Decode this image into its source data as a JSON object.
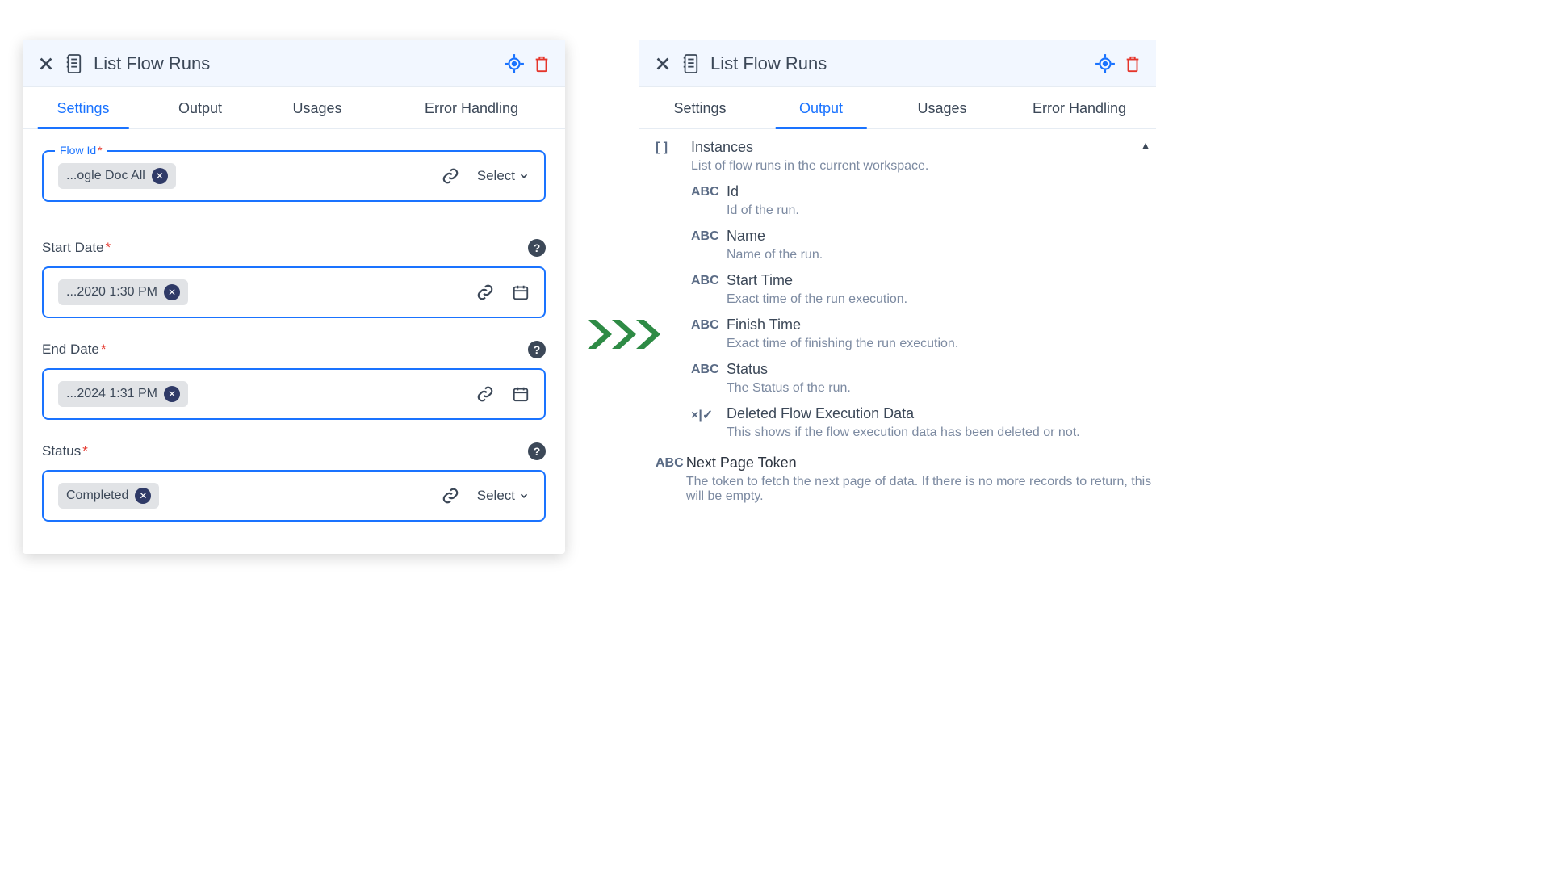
{
  "left": {
    "title": "List Flow Runs",
    "tabs": {
      "settings": "Settings",
      "output": "Output",
      "usages": "Usages",
      "error": "Error Handling",
      "active": "settings"
    },
    "flowId": {
      "label": "Flow Id",
      "chip": "...ogle Doc All",
      "select": "Select"
    },
    "start": {
      "label": "Start Date",
      "chip": "...2020 1:30 PM"
    },
    "end": {
      "label": "End Date",
      "chip": "...2024 1:31 PM"
    },
    "status": {
      "label": "Status",
      "chip": "Completed",
      "select": "Select"
    }
  },
  "right": {
    "title": "List Flow Runs",
    "tabs": {
      "settings": "Settings",
      "output": "Output",
      "usages": "Usages",
      "error": "Error Handling",
      "active": "output"
    },
    "root": {
      "icon": "[ ]",
      "name": "Instances",
      "desc": "List of flow runs in the current workspace."
    },
    "props": [
      {
        "icon": "ABC",
        "name": "Id",
        "desc": "Id of the run."
      },
      {
        "icon": "ABC",
        "name": "Name",
        "desc": "Name of the run."
      },
      {
        "icon": "ABC",
        "name": "Start Time",
        "desc": "Exact time of the run execution."
      },
      {
        "icon": "ABC",
        "name": "Finish Time",
        "desc": "Exact time of finishing the run execution."
      },
      {
        "icon": "ABC",
        "name": "Status",
        "desc": "The Status of the run."
      },
      {
        "icon": "×|✓",
        "name": "Deleted Flow Execution Data",
        "desc": "This shows if the flow execution data has been deleted or not."
      }
    ],
    "next": {
      "icon": "ABC",
      "name": "Next Page Token",
      "desc": "The token to fetch the next page of data. If there is no more records to return, this will be empty."
    }
  }
}
